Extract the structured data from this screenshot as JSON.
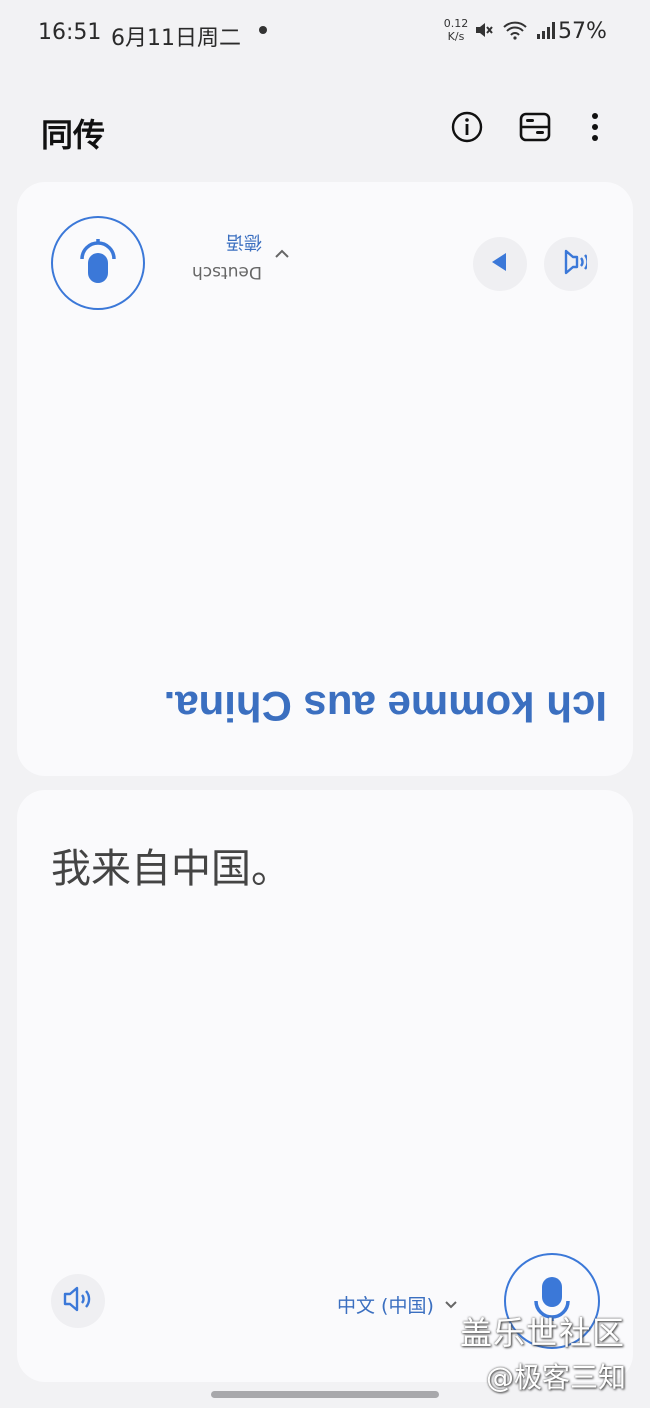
{
  "status_bar": {
    "time": "16:51",
    "date": "6月11日周二",
    "net_speed_value": "0.12",
    "net_speed_unit": "K/s",
    "battery": "57%",
    "icons": [
      "mute-icon",
      "wifi-icon",
      "signal-icon"
    ]
  },
  "header": {
    "title": "同传",
    "icons": [
      "info-icon",
      "layout-icon",
      "more-vertical-icon"
    ]
  },
  "top_panel": {
    "language_native": "Deutsch",
    "language_label": "德语",
    "translated_text": "Ich komme aus China.",
    "icons": [
      "mic-icon",
      "play-icon",
      "speaker-icon"
    ]
  },
  "bottom_panel": {
    "source_text": "我来自中国。",
    "language_label": "中文 (中国)",
    "icons": [
      "speaker-icon",
      "chevron-down-icon",
      "mic-icon"
    ]
  },
  "watermark": {
    "line1": "盖乐世社区",
    "line2": "@极客三知"
  },
  "colors": {
    "accent": "#3b78d8",
    "accent_text": "#3b6fc0",
    "panel_bg": "#fafafc",
    "page_bg": "#f2f2f4"
  }
}
